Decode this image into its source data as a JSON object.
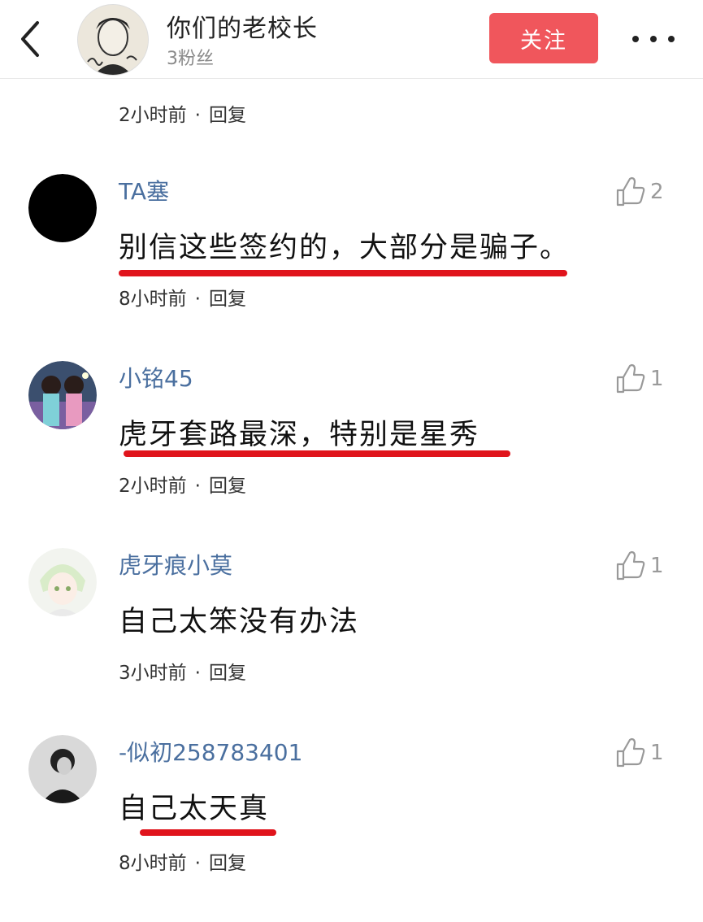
{
  "header": {
    "name": "你们的老校长",
    "fans": "3粉丝",
    "follow_label": "关注"
  },
  "top_meta": {
    "time": "2小时前",
    "reply": "回复"
  },
  "comments": [
    {
      "user": "TA塞",
      "likes": "2",
      "text": "别信这些签约的，大部分是骗子。",
      "time": "8小时前",
      "reply": "回复",
      "underlined": true
    },
    {
      "user": "小铭45",
      "likes": "1",
      "text": "虎牙套路最深，特别是星秀",
      "time": "2小时前",
      "reply": "回复",
      "underlined": true
    },
    {
      "user": "虎牙痕小莫",
      "likes": "1",
      "text": "自己太笨没有办法",
      "time": "3小时前",
      "reply": "回复",
      "underlined": false
    },
    {
      "user": "-似初258783401",
      "likes": "1",
      "text": "自己太天真",
      "time": "8小时前",
      "reply": "回复",
      "underlined": true
    }
  ],
  "colors": {
    "follow": "#f0565c",
    "username": "#4a6f9f",
    "underline": "#e0141c"
  },
  "icons": [
    "back-icon",
    "more-icon",
    "thumbs-up-icon"
  ]
}
